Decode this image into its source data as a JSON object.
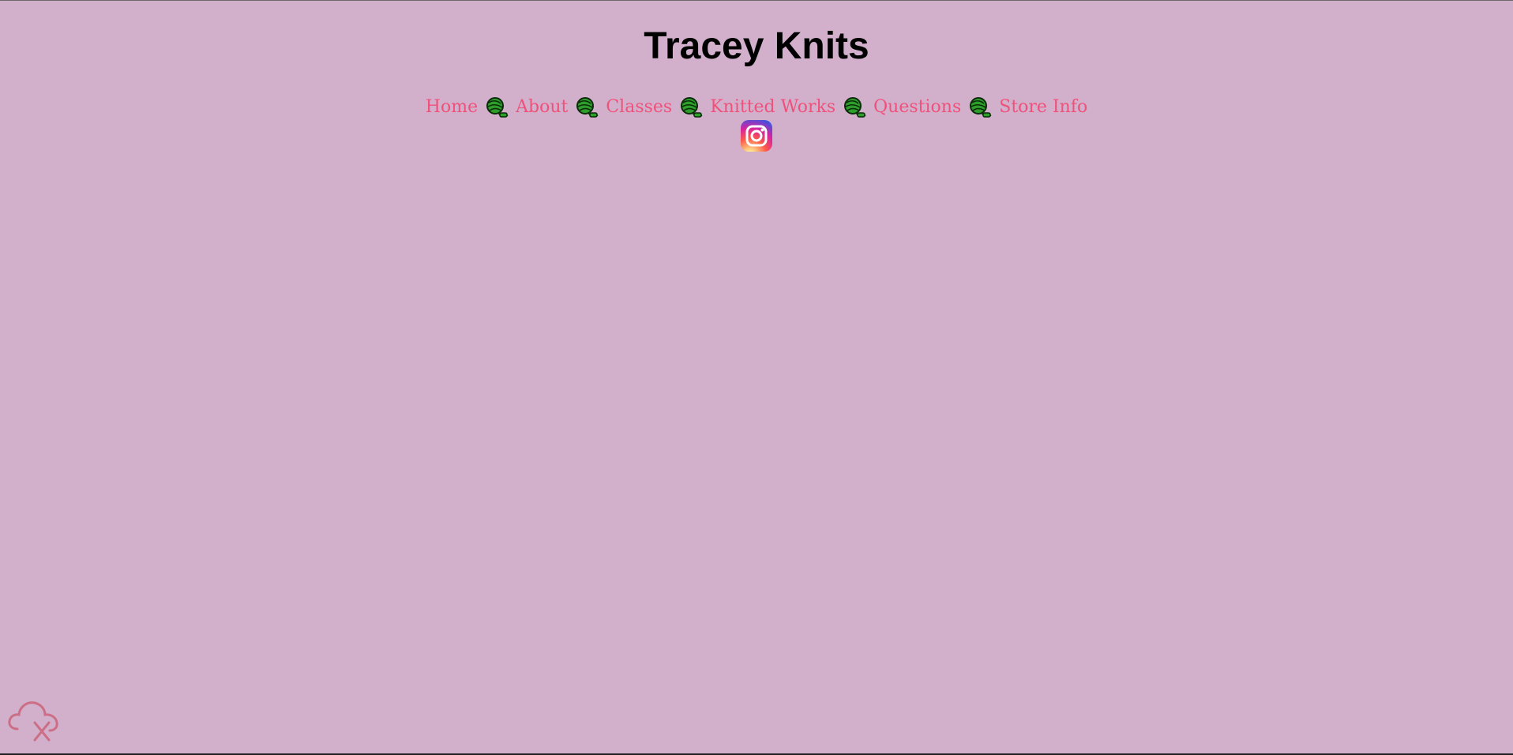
{
  "site": {
    "title": "Tracey Knits"
  },
  "nav": {
    "items": [
      {
        "label": "Home"
      },
      {
        "label": "About"
      },
      {
        "label": "Classes"
      },
      {
        "label": "Knitted Works"
      },
      {
        "label": "Questions"
      },
      {
        "label": "Store Info"
      }
    ],
    "separator_icon": "yarn-ball-icon",
    "social_icon": "instagram-icon"
  },
  "status": {
    "icon": "cloud-offline-icon"
  },
  "colors": {
    "background": "#d2b0cc",
    "link": "#f0517a",
    "title": "#000000",
    "yarn": "#2e9e2a",
    "cloud": "#cc6f86"
  }
}
